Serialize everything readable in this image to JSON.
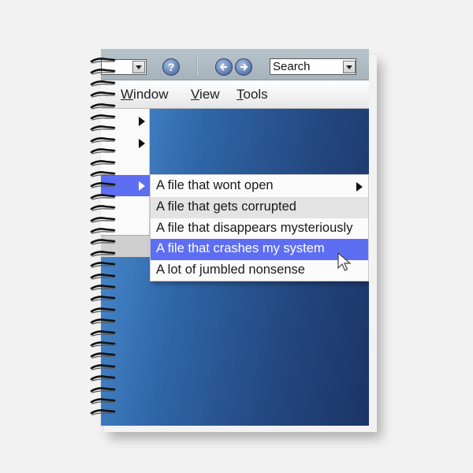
{
  "toolbar": {
    "help_glyph": "?",
    "search_value": "Search"
  },
  "menubar": {
    "items": [
      {
        "first": "W",
        "rest": "indow"
      },
      {
        "first": "V",
        "rest": "iew"
      },
      {
        "first": "T",
        "rest": "ools"
      }
    ]
  },
  "submenu": {
    "items": [
      "A file that wont open",
      "A file that gets corrupted",
      "A file that disappears mysteriously",
      "A file that crashes my system",
      "A lot of jumbled nonsense"
    ],
    "selected_index": 3,
    "hover_index": 1
  },
  "colors": {
    "highlight": "#5e6ef2",
    "desktop_light": "#4f93d6",
    "desktop_dark": "#1c3466",
    "page_background": "#f2f2f2"
  },
  "icons": {
    "help": "help-icon",
    "back": "arrow-left-icon",
    "forward": "arrow-right-icon",
    "cursor": "mouse-pointer-icon",
    "submenu_arrow": "triangle-right-icon"
  }
}
